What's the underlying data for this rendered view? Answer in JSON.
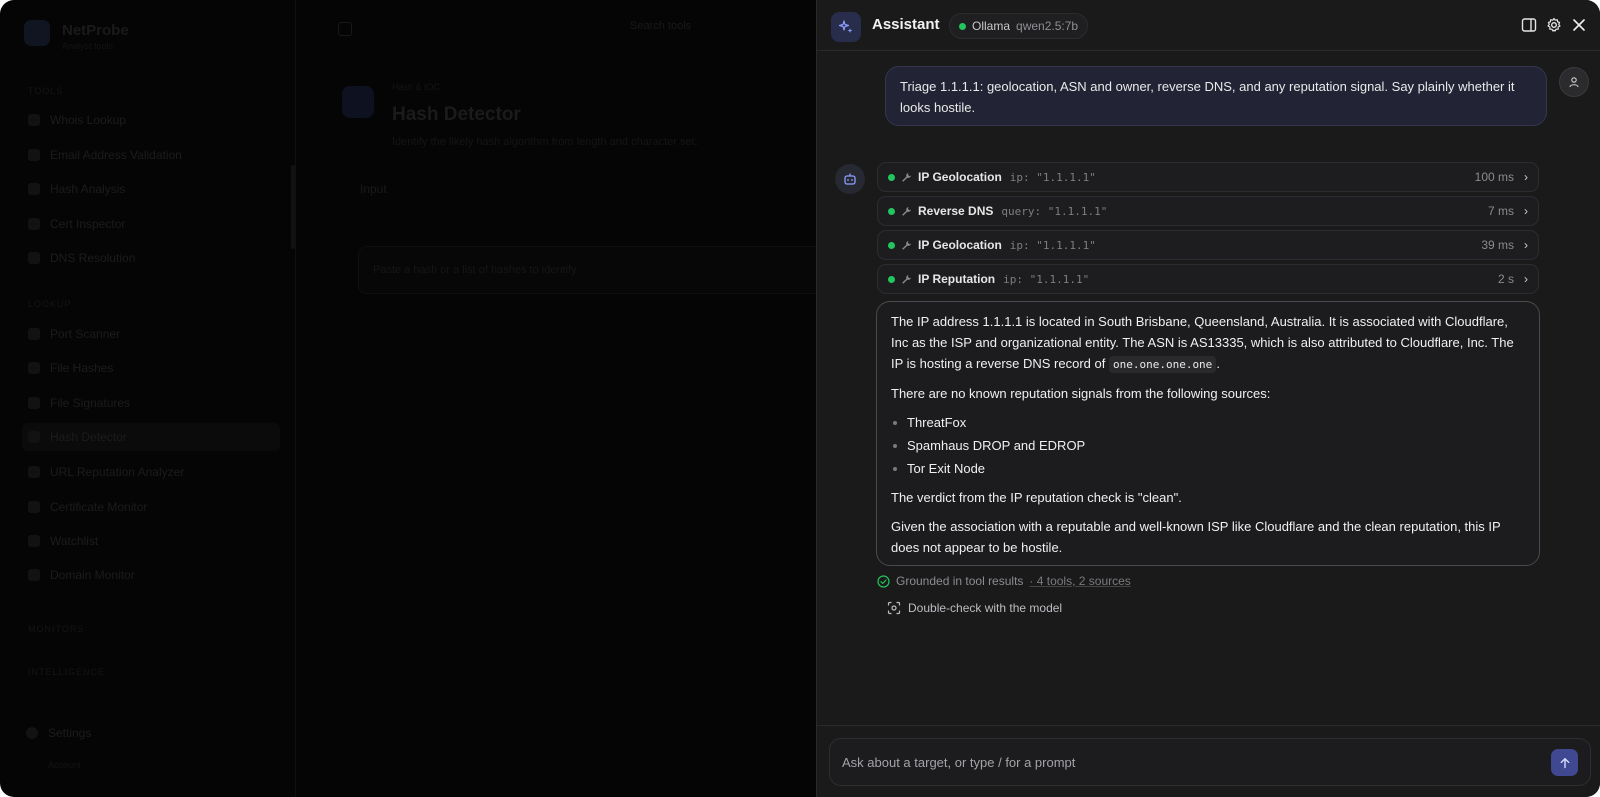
{
  "background_app": {
    "brand": "NetProbe",
    "brand_sub": "Analyst tools",
    "sections": [
      {
        "label": "TOOLS"
      },
      {
        "label": "LOOKUP"
      },
      {
        "label": "MONITORS"
      },
      {
        "label": "INTELLIGENCE"
      }
    ],
    "items": [
      {
        "label": "Whois Lookup"
      },
      {
        "label": "Email Address Validation"
      },
      {
        "label": "Hash Analysis"
      },
      {
        "label": "Cert Inspector"
      },
      {
        "label": "DNS Resolution"
      },
      {
        "label": "Port Scanner"
      },
      {
        "label": "File Hashes"
      },
      {
        "label": "File Signatures"
      },
      {
        "label": "Hash Detector"
      },
      {
        "label": "URL Reputation Analyzer"
      },
      {
        "label": "Certificate Monitor"
      },
      {
        "label": "Watchlist"
      },
      {
        "label": "Domain Monitor"
      }
    ],
    "search_label": "Search tools",
    "page_crumb": "Hash & IOC",
    "page_title": "Hash Detector",
    "page_desc": "Identify the likely hash algorithm from length and character set.",
    "tab_label": "Input",
    "input_placeholder": "Paste a hash or a list of hashes to identify",
    "settings_label": "Settings",
    "settings_sub": "Account"
  },
  "assistant": {
    "title": "Assistant",
    "model": {
      "provider": "Ollama",
      "name": "qwen2.5:7b",
      "status_color": "#22c55e"
    },
    "header_icons": [
      "sidebar-toggle-icon",
      "gear-icon",
      "close-icon"
    ],
    "user_message": "Triage 1.1.1.1: geolocation, ASN and owner, reverse DNS, and any reputation signal. Say plainly whether it looks hostile.",
    "tool_calls": [
      {
        "name": "IP Geolocation",
        "arg": "ip: \"1.1.1.1\"",
        "time": "100 ms"
      },
      {
        "name": "Reverse DNS",
        "arg": "query: \"1.1.1.1\"",
        "time": "7 ms"
      },
      {
        "name": "IP Geolocation",
        "arg": "ip: \"1.1.1.1\"",
        "time": "39 ms"
      },
      {
        "name": "IP Reputation",
        "arg": "ip: \"1.1.1.1\"",
        "time": "2 s"
      }
    ],
    "answer": {
      "p1_pre": "The IP address 1.1.1.1 is located in South Brisbane, Queensland, Australia. It is associated with Cloudflare, Inc as the ISP and organizational entity. The ASN is AS13335, which is also attributed to Cloudflare, Inc. The IP is hosting a reverse DNS record of ",
      "p1_code": "one.one.one.one",
      "p1_post": ".",
      "p2": "There are no known reputation signals from the following sources:",
      "bullets": [
        "ThreatFox",
        "Spamhaus DROP and EDROP",
        "Tor Exit Node"
      ],
      "p3": "The verdict from the IP reputation check is \"clean\".",
      "p4": "Given the association with a reputable and well-known ISP like Cloudflare and the clean reputation, this IP does not appear to be hostile."
    },
    "grounded": {
      "label": "Grounded in tool results",
      "detail": "· 4 tools, 2 sources"
    },
    "double_check_label": "Double-check with the model",
    "composer_placeholder": "Ask about a target, or type / for a prompt",
    "accent": "#3f4891"
  }
}
